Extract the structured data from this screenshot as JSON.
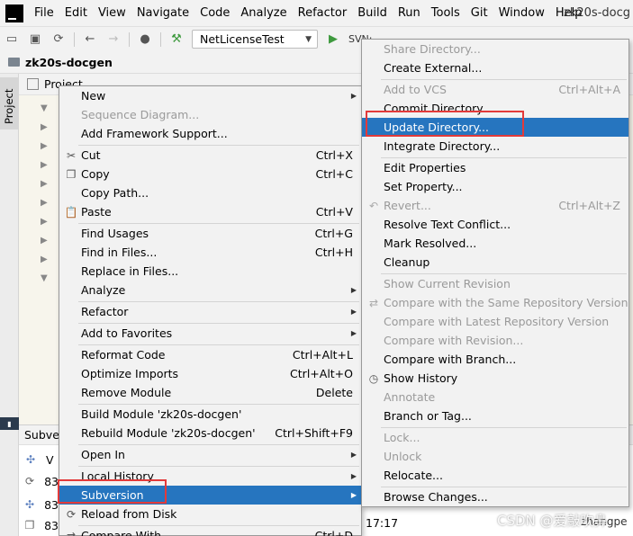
{
  "menubar": {
    "items": [
      "File",
      "Edit",
      "View",
      "Navigate",
      "Code",
      "Analyze",
      "Refactor",
      "Build",
      "Run",
      "Tools",
      "Git",
      "Window",
      "Help"
    ],
    "title": "zk20s-docg"
  },
  "toolbar": {
    "run_config": "NetLicenseTest",
    "svn_label": "SVN:"
  },
  "breadcrumb": {
    "project": "zk20s-docgen"
  },
  "left_strip": {
    "project_tab": "Project"
  },
  "project_panel": {
    "title": "Project"
  },
  "bottom_panel": {
    "title": "Subversi",
    "rows": [
      "V",
      "83",
      "83",
      "83"
    ],
    "time": "17:17",
    "author": "zhangpe"
  },
  "watermark": "CSDN @爱敲吹鼻",
  "context_menu": {
    "items": [
      {
        "label": "New",
        "submenu": true
      },
      {
        "label": "Sequence Diagram...",
        "disabled": true
      },
      {
        "label": "Add Framework Support..."
      },
      {
        "label": "Cut",
        "shortcut": "Ctrl+X",
        "icon": "cut-icon"
      },
      {
        "label": "Copy",
        "shortcut": "Ctrl+C",
        "icon": "copy-icon"
      },
      {
        "label": "Copy Path..."
      },
      {
        "label": "Paste",
        "shortcut": "Ctrl+V",
        "icon": "paste-icon"
      },
      {
        "label": "Find Usages",
        "shortcut": "Ctrl+G"
      },
      {
        "label": "Find in Files...",
        "shortcut": "Ctrl+H"
      },
      {
        "label": "Replace in Files..."
      },
      {
        "label": "Analyze",
        "submenu": true
      },
      {
        "label": "Refactor",
        "submenu": true
      },
      {
        "label": "Add to Favorites",
        "submenu": true
      },
      {
        "label": "Reformat Code",
        "shortcut": "Ctrl+Alt+L"
      },
      {
        "label": "Optimize Imports",
        "shortcut": "Ctrl+Alt+O"
      },
      {
        "label": "Remove Module",
        "shortcut": "Delete"
      },
      {
        "label": "Build Module 'zk20s-docgen'"
      },
      {
        "label": "Rebuild Module 'zk20s-docgen'",
        "shortcut": "Ctrl+Shift+F9"
      },
      {
        "label": "Open In",
        "submenu": true
      },
      {
        "label": "Local History",
        "submenu": true
      },
      {
        "label": "Subversion",
        "submenu": true,
        "selected": true
      },
      {
        "label": "Reload from Disk",
        "icon": "reload-icon"
      },
      {
        "label": "Compare With...",
        "shortcut": "Ctrl+D"
      }
    ]
  },
  "submenu": {
    "items": [
      {
        "label": "Share Directory...",
        "disabled": true
      },
      {
        "label": "Create External..."
      },
      {
        "label": "Add to VCS",
        "shortcut": "Ctrl+Alt+A",
        "disabled": true
      },
      {
        "label": "Commit Directory..."
      },
      {
        "label": "Update Directory...",
        "selected": true
      },
      {
        "label": "Integrate Directory..."
      },
      {
        "label": "Edit Properties"
      },
      {
        "label": "Set Property..."
      },
      {
        "label": "Revert...",
        "shortcut": "Ctrl+Alt+Z",
        "disabled": true,
        "icon": "revert-icon"
      },
      {
        "label": "Resolve Text Conflict..."
      },
      {
        "label": "Mark Resolved..."
      },
      {
        "label": "Cleanup"
      },
      {
        "label": "Show Current Revision",
        "disabled": true
      },
      {
        "label": "Compare with the Same Repository Version",
        "disabled": true,
        "icon": "compare-icon"
      },
      {
        "label": "Compare with Latest Repository Version",
        "disabled": true
      },
      {
        "label": "Compare with Revision...",
        "disabled": true
      },
      {
        "label": "Compare with Branch..."
      },
      {
        "label": "Show History",
        "icon": "history-icon"
      },
      {
        "label": "Annotate",
        "disabled": true
      },
      {
        "label": "Branch or Tag..."
      },
      {
        "label": "Lock...",
        "disabled": true
      },
      {
        "label": "Unlock",
        "disabled": true
      },
      {
        "label": "Relocate..."
      },
      {
        "label": "Browse Changes..."
      }
    ]
  },
  "colors": {
    "selection": "#2675bf",
    "highlight_box": "#e23a3a",
    "menu_bg": "#f2f2f2"
  }
}
